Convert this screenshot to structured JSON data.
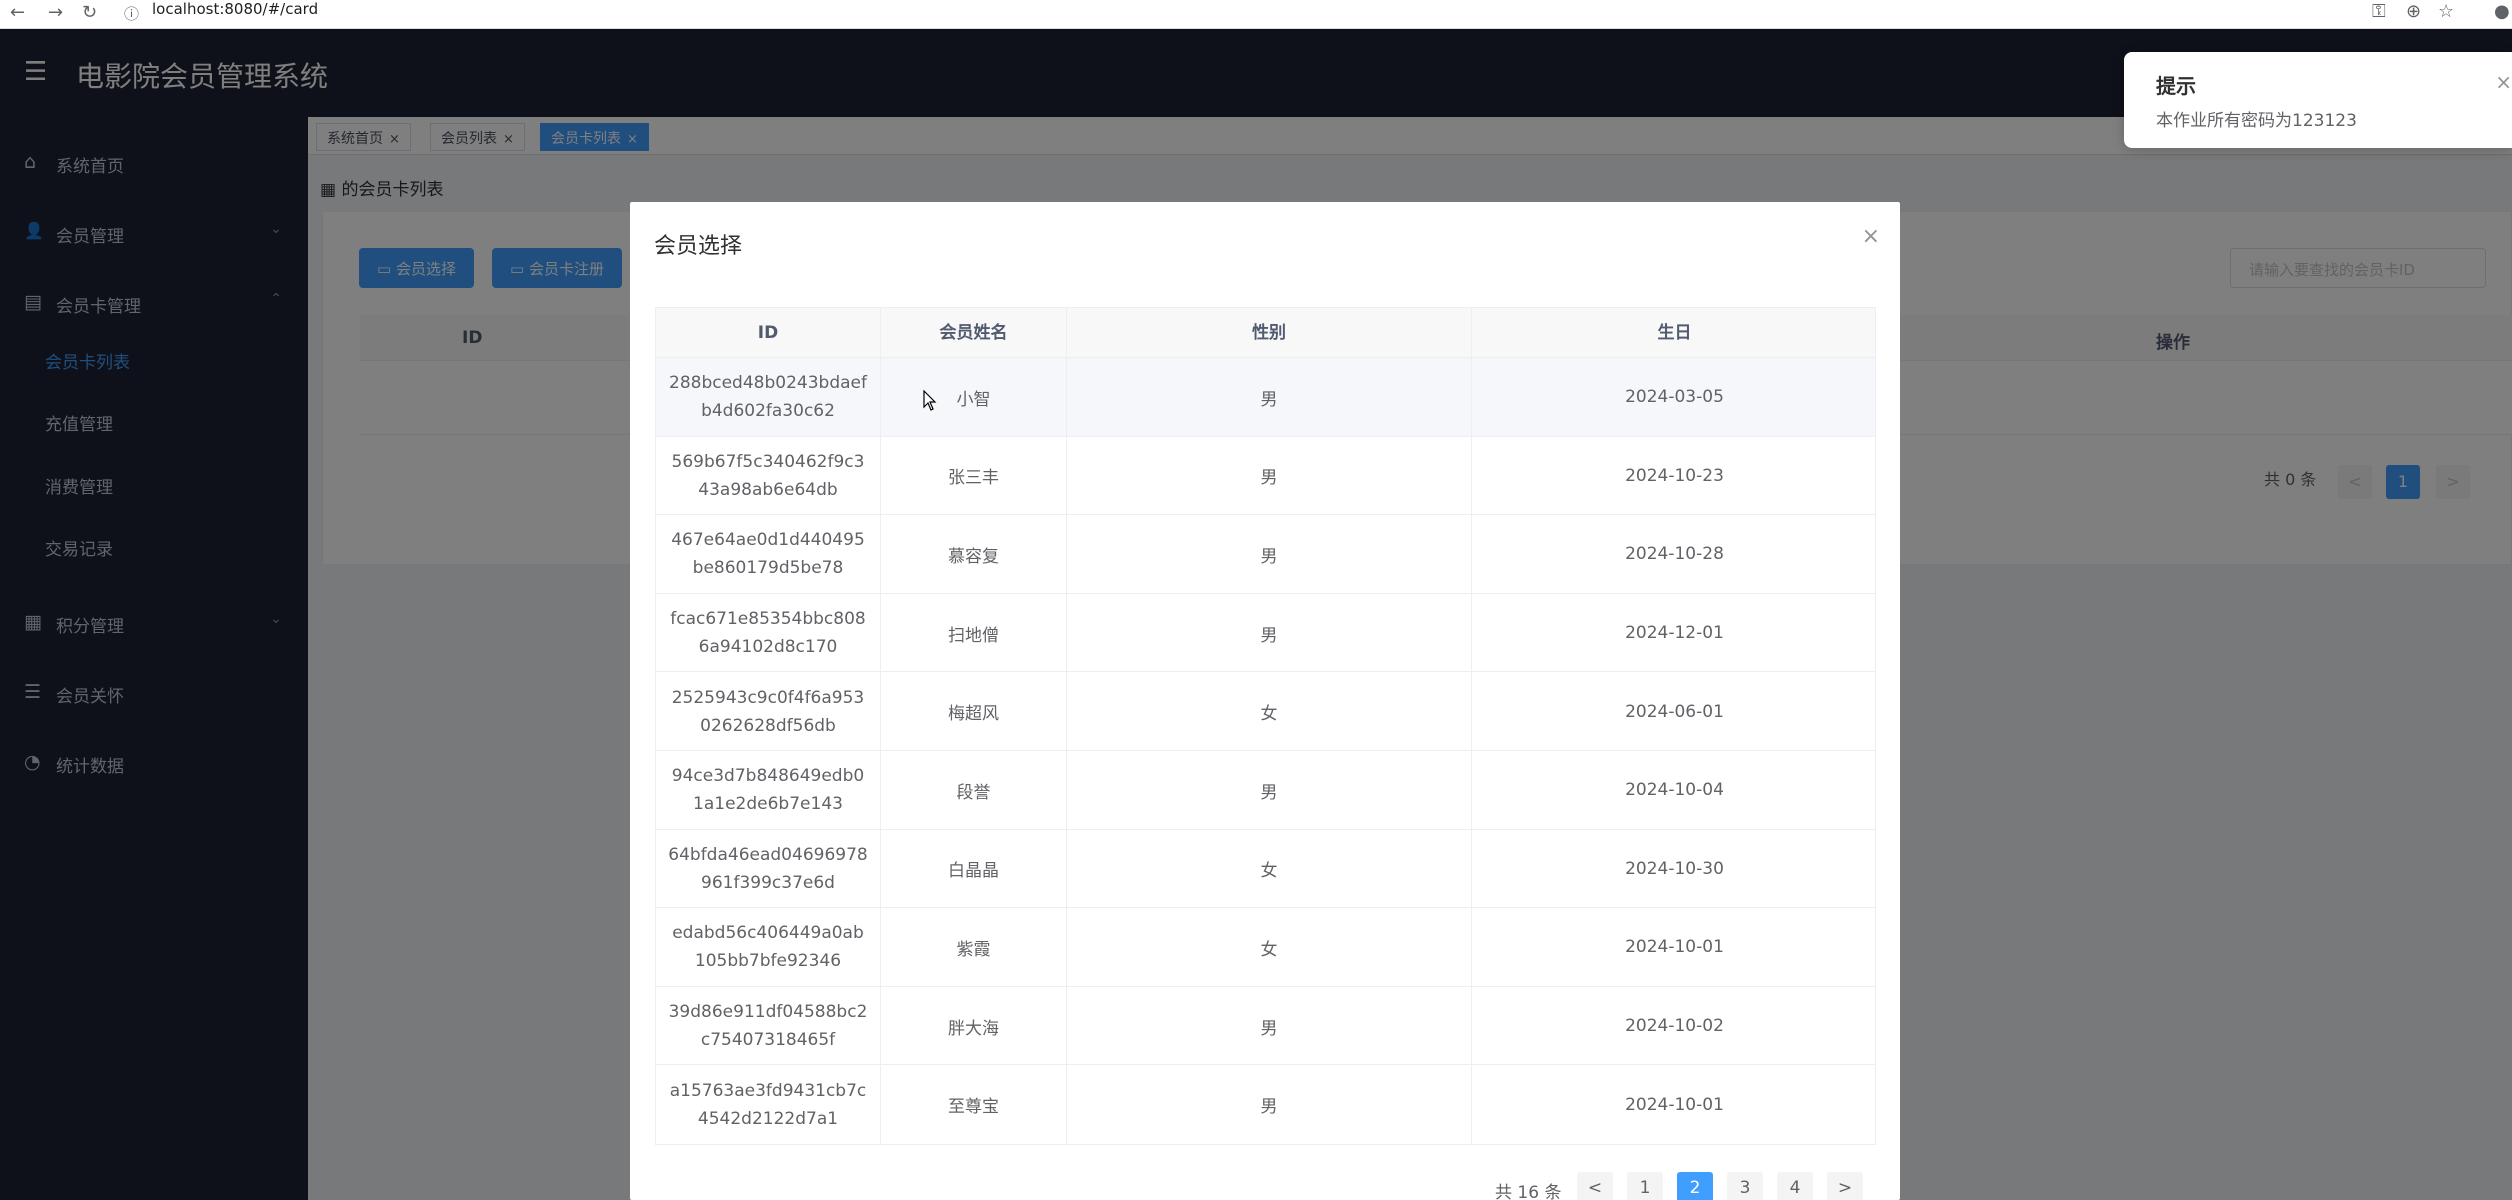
{
  "browser": {
    "url": "localhost:8080/#/card",
    "back_icon": "←",
    "forward_icon": "→",
    "reload_icon": "↻",
    "info_icon": "ⓘ"
  },
  "header": {
    "menu_icon": "☰",
    "title": "电影院会员管理系统"
  },
  "sidebar": {
    "items": [
      {
        "label": "系统首页",
        "icon": "⌂"
      },
      {
        "label": "会员管理",
        "icon": "👤"
      },
      {
        "label": "会员卡管理",
        "icon": "▤"
      },
      {
        "label": "积分管理",
        "icon": "▦"
      },
      {
        "label": "会员关怀",
        "icon": "☰"
      },
      {
        "label": "统计数据",
        "icon": "◔"
      }
    ],
    "sub_items": [
      {
        "label": "会员卡列表"
      },
      {
        "label": "充值管理"
      },
      {
        "label": "消费管理"
      },
      {
        "label": "交易记录"
      }
    ]
  },
  "tabs": [
    {
      "label": "系统首页"
    },
    {
      "label": "会员列表"
    },
    {
      "label": "会员卡列表"
    }
  ],
  "tab_close": "×",
  "page": {
    "breadcrumb": "的会员卡列表",
    "select_member_button": "会员选择",
    "register_card_button": "会员卡注册",
    "search_placeholder": "请输入要查找的会员卡ID",
    "table_headers": {
      "id": "ID",
      "action": "操作"
    },
    "pager": {
      "total": "共 0 条",
      "current": "1",
      "prev": "<",
      "next": ">"
    }
  },
  "modal": {
    "title": "会员选择",
    "close": "×",
    "headers": {
      "id": "ID",
      "name": "会员姓名",
      "gender": "性别",
      "birthday": "生日"
    },
    "rows": [
      {
        "id": "288bced48b0243bdaefb4d602fa30c62",
        "name": "小智",
        "gender": "男",
        "birthday": "2024-03-05"
      },
      {
        "id": "569b67f5c340462f9c343a98ab6e64db",
        "name": "张三丰",
        "gender": "男",
        "birthday": "2024-10-23"
      },
      {
        "id": "467e64ae0d1d440495be860179d5be78",
        "name": "慕容复",
        "gender": "男",
        "birthday": "2024-10-28"
      },
      {
        "id": "fcac671e85354bbc8086a94102d8c170",
        "name": "扫地僧",
        "gender": "男",
        "birthday": "2024-12-01"
      },
      {
        "id": "2525943c9c0f4f6a9530262628df56db",
        "name": "梅超风",
        "gender": "女",
        "birthday": "2024-06-01"
      },
      {
        "id": "94ce3d7b848649edb01a1e2de6b7e143",
        "name": "段誉",
        "gender": "男",
        "birthday": "2024-10-04"
      },
      {
        "id": "64bfda46ead04696978961f399c37e6d",
        "name": "白晶晶",
        "gender": "女",
        "birthday": "2024-10-30"
      },
      {
        "id": "edabd56c406449a0ab105bb7bfe92346",
        "name": "紫霞",
        "gender": "女",
        "birthday": "2024-10-01"
      },
      {
        "id": "39d86e911df04588bc2c75407318465f",
        "name": "胖大海",
        "gender": "男",
        "birthday": "2024-10-02"
      },
      {
        "id": "a15763ae3fd9431cb7c4542d2122d7a1",
        "name": "至尊宝",
        "gender": "男",
        "birthday": "2024-10-01"
      }
    ],
    "pager": {
      "total": "共 16 条",
      "prev": "<",
      "next": ">",
      "pages": [
        "1",
        "2",
        "3",
        "4"
      ],
      "current": "2"
    }
  },
  "notification": {
    "title": "提示",
    "message": "本作业所有密码为123123",
    "close": "×"
  },
  "colors": {
    "accent": "#409eff",
    "sidebar_bg": "#1d2332"
  }
}
